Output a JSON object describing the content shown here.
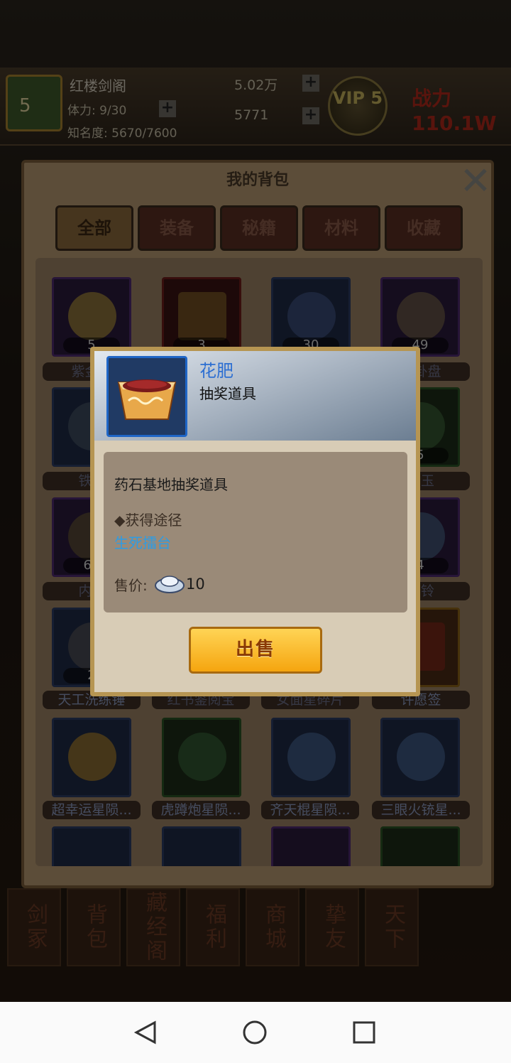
{
  "game": {
    "player_name": "红楼剑阁",
    "level": "5",
    "stamina": "体力: 9/30",
    "fame": "知名度: 5670/7600",
    "silver": "5.02万",
    "gold": "5771",
    "vip": "VIP\n5",
    "power": "战力 110.1W"
  },
  "bottom_nav": [
    "剑冢",
    "背包",
    "藏经阁",
    "福利",
    "商城",
    "挚友",
    "天下"
  ],
  "bag": {
    "title": "我的背包",
    "tabs": [
      "全部",
      "装备",
      "秘籍",
      "材料",
      "收藏"
    ],
    "slots": [
      {
        "count": "5",
        "name": "紫金令"
      },
      {
        "count": "3",
        "name": ""
      },
      {
        "count": "30",
        "name": ""
      },
      {
        "count": "49",
        "name": "八卦盘"
      },
      {
        "count": "",
        "name": "铁..."
      },
      {
        "count": "",
        "name": ""
      },
      {
        "count": "",
        "name": ""
      },
      {
        "count": "5",
        "name": "劝玉"
      },
      {
        "count": "64",
        "name": "内..."
      },
      {
        "count": "",
        "name": ""
      },
      {
        "count": "",
        "name": ""
      },
      {
        "count": "4",
        "name": "青铃"
      },
      {
        "count": "2",
        "name": "天工洗练锤"
      },
      {
        "count": "",
        "name": "红书鉴阅宝"
      },
      {
        "count": "",
        "name": "女面星碎片"
      },
      {
        "count": "",
        "name": "许愿签"
      },
      {
        "count": "",
        "name": "超幸运星陨..."
      },
      {
        "count": "",
        "name": "虎蹲炮星陨..."
      },
      {
        "count": "",
        "name": "齐天棍星陨..."
      },
      {
        "count": "",
        "name": "三眼火铳星..."
      }
    ]
  },
  "popup": {
    "item_name": "花肥",
    "item_type": "抽奖道具",
    "description": "药石基地抽奖道具",
    "source_title": "◆获得途径",
    "source_link": "生死擂台",
    "price_label": "售价:",
    "price_value": "10",
    "sell_label": "出售"
  },
  "colors": {
    "item_name": "#2d6fd2",
    "source_link": "#2e9ce3",
    "sell_button": "#f7b520"
  },
  "icons": {
    "close": "close-x-icon",
    "price_currency": "silver-ingot-icon",
    "item": "flower-fertilizer-box-icon",
    "sys_back": "triangle-back-icon",
    "sys_home": "circle-home-icon",
    "sys_recent": "square-recents-icon"
  }
}
